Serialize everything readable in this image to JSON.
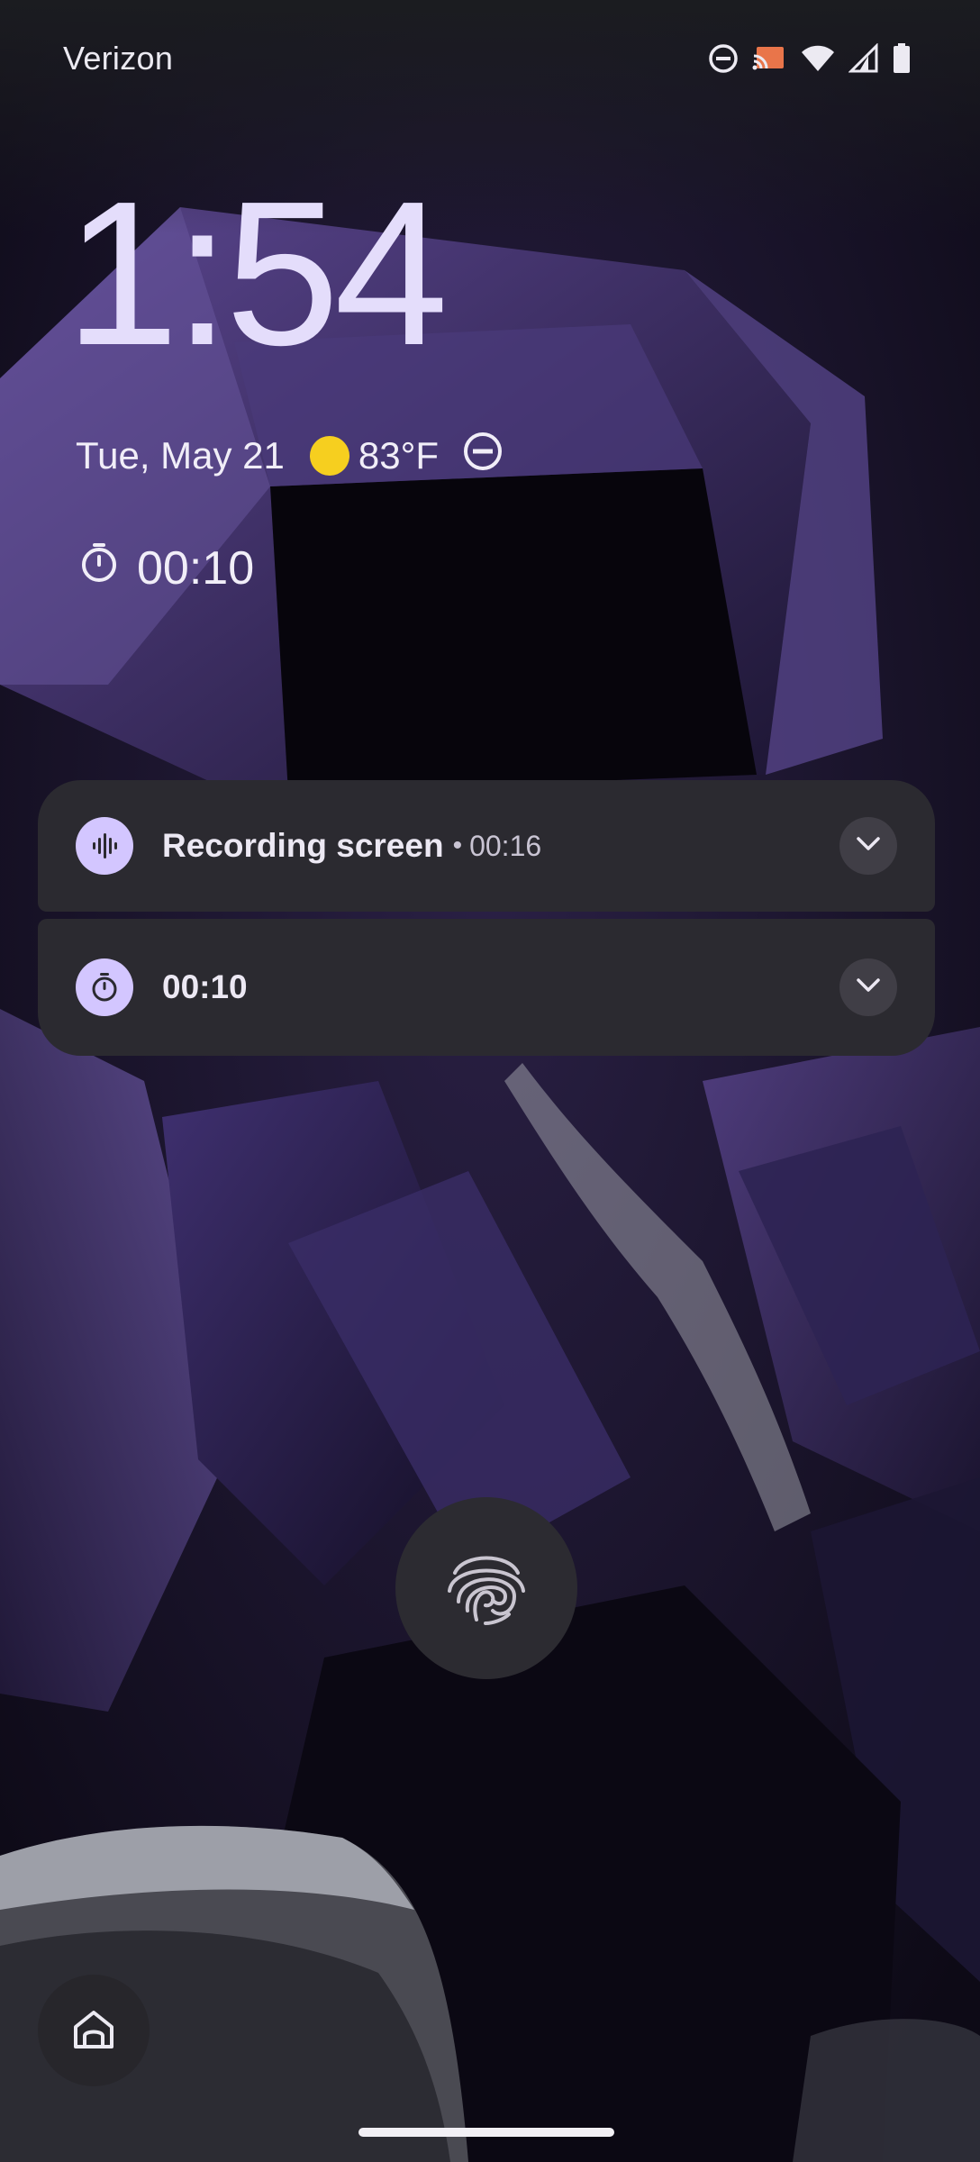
{
  "status_bar": {
    "carrier": "Verizon",
    "icons": [
      "do-not-disturb-icon",
      "cast-icon",
      "wifi-icon",
      "cell-signal-icon",
      "battery-icon"
    ]
  },
  "lockscreen": {
    "clock": "1:54",
    "date": "Tue, May 21",
    "temperature": "83°F",
    "timer": "00:10"
  },
  "notifications": [
    {
      "app_icon": "sound-wave-icon",
      "title": "Recording screen",
      "separator": "•",
      "time": "00:16"
    },
    {
      "app_icon": "timer-icon",
      "title": "00:10"
    }
  ],
  "bottom": {
    "fingerprint_icon": "fingerprint-icon",
    "shortcut_icon": "home-icon"
  },
  "colors": {
    "accent": "#d3c6ff",
    "clock": "#e4ddfb",
    "notification_bg": "#2b2a30",
    "sun": "#f6cf1f"
  }
}
